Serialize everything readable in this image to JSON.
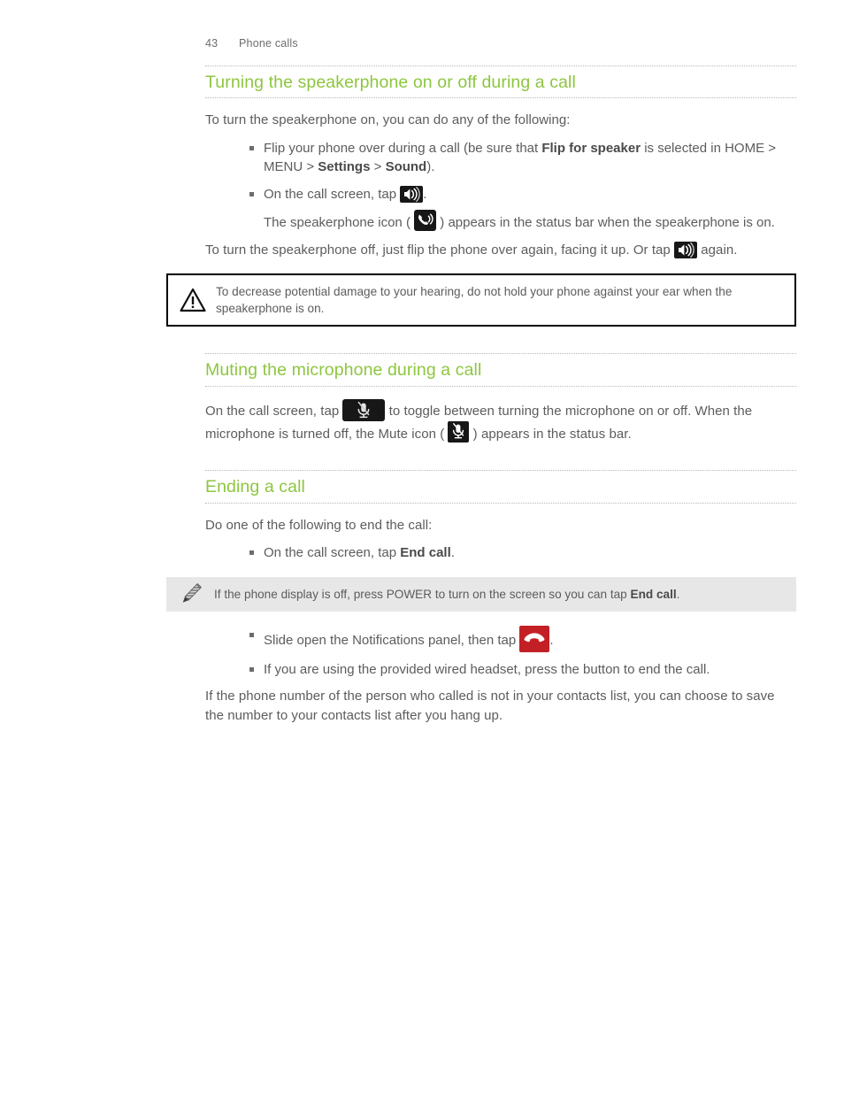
{
  "header": {
    "page_number": "43",
    "chapter": "Phone calls"
  },
  "colors": {
    "heading_green": "#8dc63f",
    "body_text": "#5c5c5c",
    "rule_dotted": "#b9b9b9",
    "note_background": "#e7e7e7",
    "warning_border": "#000000",
    "endcall_red": "#c32026",
    "icon_chip_dark": "#171717"
  },
  "sections": [
    {
      "id": "speakerphone",
      "heading": "Turning the speakerphone on or off during a call",
      "intro": "To turn the speakerphone on, you can do any of the following:",
      "bullets": [
        {
          "parts": [
            {
              "type": "text",
              "value": "Flip your phone over during a call (be sure that "
            },
            {
              "type": "bold",
              "value": "Flip for speaker"
            },
            {
              "type": "text",
              "value": " is selected in HOME > MENU > "
            },
            {
              "type": "bold",
              "value": "Settings"
            },
            {
              "type": "text",
              "value": " > "
            },
            {
              "type": "bold",
              "value": "Sound"
            },
            {
              "type": "text",
              "value": ")."
            }
          ]
        },
        {
          "parts": [
            {
              "type": "text",
              "value": "On the call screen, tap "
            },
            {
              "type": "icon",
              "value": "speakerphone-on-button-icon"
            },
            {
              "type": "text",
              "value": "."
            }
          ]
        }
      ],
      "note_line": {
        "before": "The speakerphone icon ( ",
        "icon": "speakerphone-status-icon",
        "after": " ) appears in the status bar when the speakerphone is on."
      },
      "outro": {
        "before": "To turn the speakerphone off, just flip the phone over again, facing it up. Or tap ",
        "icon": "speakerphone-on-button-icon",
        "after": " again."
      },
      "warning": "To decrease potential damage to your hearing, do not hold your phone against your ear when the speakerphone is on."
    },
    {
      "id": "mute",
      "heading": "Muting the microphone during a call",
      "body": {
        "part1": "On the call screen, tap ",
        "icon1": "mute-button-icon",
        "part2": " to toggle between turning the microphone on or off. When the microphone is turned off, the Mute icon ( ",
        "icon2": "mute-status-icon",
        "part3": " ) appears in the status bar."
      }
    },
    {
      "id": "ending",
      "heading": "Ending a call",
      "intro": "Do one of the following to end the call:",
      "bullet_first": {
        "before": "On the call screen, tap ",
        "bold": "End call",
        "after": "."
      },
      "note": {
        "before": "If the phone display is off, press POWER to turn on the screen so you can tap ",
        "bold": "End call",
        "after": "."
      },
      "bullets_after": [
        {
          "before": "Slide open the Notifications panel, then tap ",
          "icon": "end-call-icon",
          "after": "."
        },
        {
          "text": "If you are using the provided wired headset, press the button to end the call."
        }
      ],
      "closing": "If the phone number of the person who called is not in your contacts list, you can choose to save the number to your contacts list after you hang up."
    }
  ]
}
